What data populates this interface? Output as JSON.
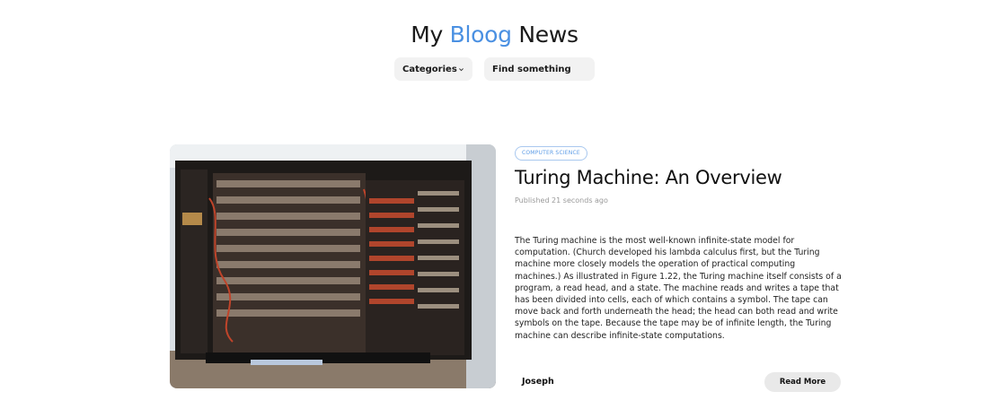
{
  "header": {
    "title_prefix": "My",
    "title_accent": "Bloog",
    "title_suffix": "News",
    "accent_color": "#4a90e2"
  },
  "controls": {
    "categories_label": "Categories",
    "search_placeholder": "Find something"
  },
  "post": {
    "tag": "COMPUTER SCIENCE",
    "title": "Turing Machine: An Overview",
    "published": "Published 21 seconds ago",
    "excerpt": "The Turing machine is the most well-known infinite-state model for computation. (Church developed his lambda calculus first, but the Turing machine more closely models the operation of practical computing machines.) As illustrated in Figure 1.22, the Turing machine itself consists of a program, a read head, and a state. The machine reads and writes a tape that has been divided into cells, each of which contains a symbol. The tape can move back and forth underneath the head; the head can both read and write symbols on the tape. Because the tape may be of infinite length, the Turing machine can describe infinite-state computations.",
    "author": "Joseph",
    "read_more_label": "Read More",
    "image_icon": "computing-machine-photo"
  }
}
